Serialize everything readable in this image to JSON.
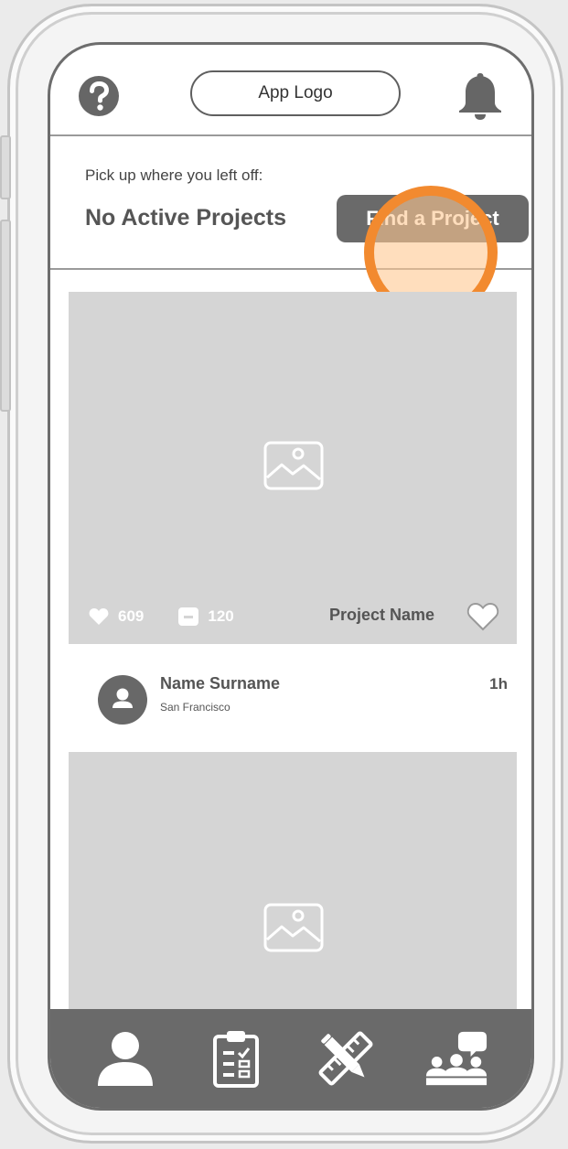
{
  "header": {
    "logo_label": "App Logo",
    "help_icon": "question-circle-icon",
    "notification_icon": "bell-icon"
  },
  "resume": {
    "subtitle": "Pick up where you left off:",
    "title": "No Active Projects",
    "cta_label": "Find a Project"
  },
  "feed": {
    "cards": [
      {
        "likes": "609",
        "comments": "120",
        "project_name": "Project Name",
        "author": {
          "name": "Name Surname",
          "location": "San Francisco",
          "time": "1h"
        }
      },
      {}
    ]
  },
  "tabbar": {
    "items": [
      {
        "icon": "profile-icon"
      },
      {
        "icon": "clipboard-checklist-icon"
      },
      {
        "icon": "pencil-ruler-icon"
      },
      {
        "icon": "community-chat-icon"
      }
    ]
  },
  "colors": {
    "highlight_ring": "#f28a2f",
    "highlight_fill": "#ffc891",
    "dark_gray": "#6a6a6a",
    "placeholder_gray": "#d5d5d5"
  }
}
